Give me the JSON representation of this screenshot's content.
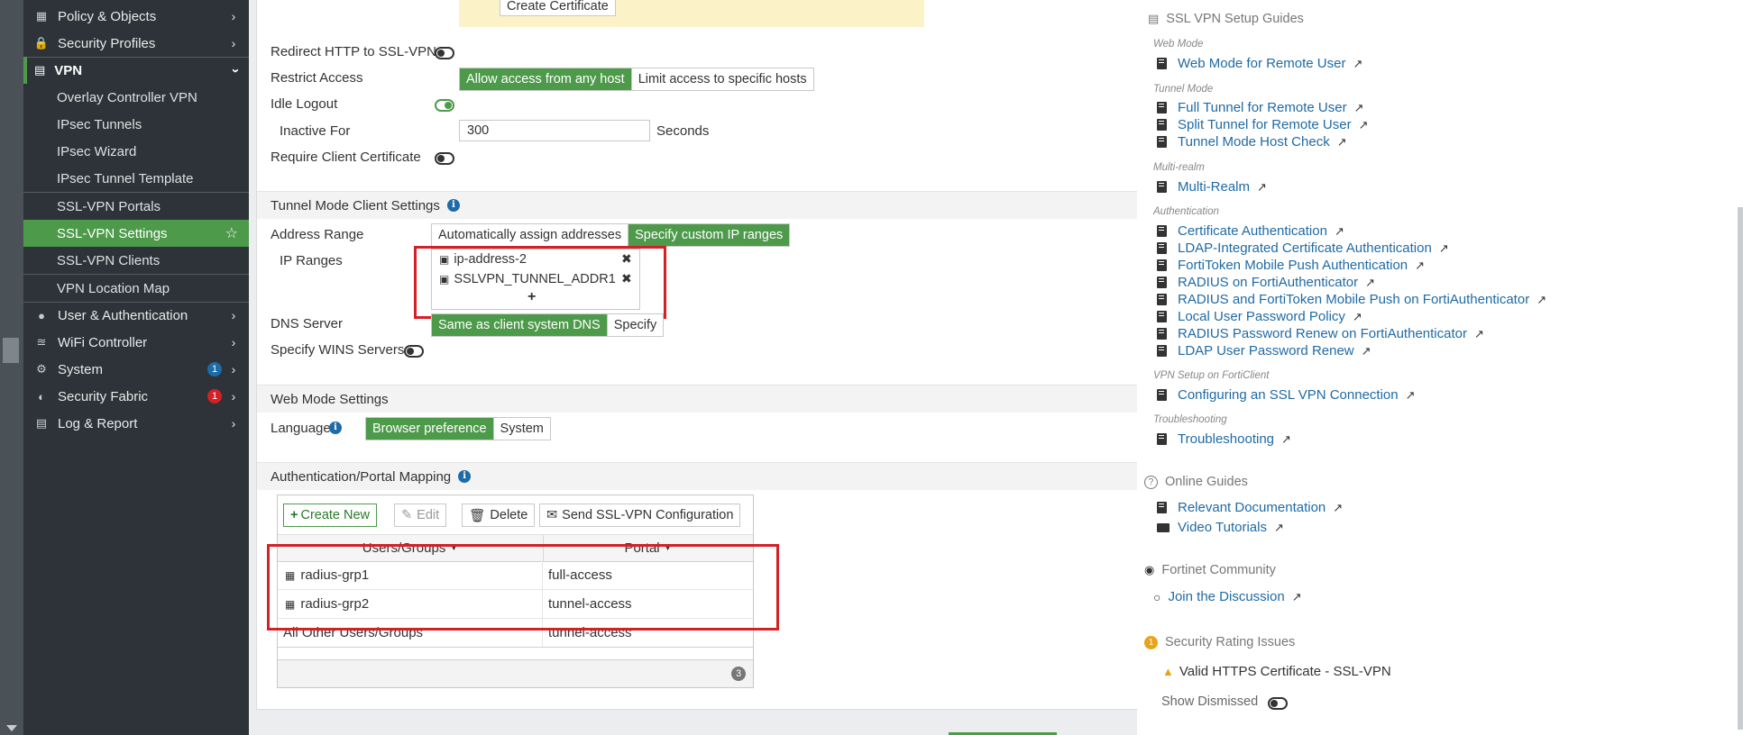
{
  "sidebar": {
    "items_top": [
      {
        "label": "Policy & Objects",
        "icon": "policy-icon"
      },
      {
        "label": "Security Profiles",
        "icon": "lock-icon"
      }
    ],
    "vpn_label": "VPN",
    "vpn_subitems": [
      "Overlay Controller VPN",
      "IPsec Tunnels",
      "IPsec Wizard",
      "IPsec Tunnel Template",
      "SSL-VPN Portals",
      "SSL-VPN Settings",
      "SSL-VPN Clients",
      "VPN Location Map"
    ],
    "active_subitem": "SSL-VPN Settings",
    "items_bottom": [
      {
        "label": "User & Authentication",
        "icon": "user-icon"
      },
      {
        "label": "WiFi Controller",
        "icon": "wifi-icon"
      },
      {
        "label": "System",
        "icon": "gear-icon",
        "badge": "1",
        "badge_color": "#1d6ba8"
      },
      {
        "label": "Security Fabric",
        "icon": "fabric-icon",
        "badge": "1",
        "badge_color": "#d42027"
      },
      {
        "label": "Log & Report",
        "icon": "chart-icon"
      }
    ]
  },
  "main": {
    "create_certificate": "Create Certificate",
    "redirect_http": "Redirect HTTP to SSL-VPN",
    "restrict_access": {
      "label": "Restrict Access",
      "options": [
        "Allow access from any host",
        "Limit access to specific hosts"
      ],
      "selected": 0
    },
    "idle_logout": "Idle Logout",
    "inactive_for": {
      "label": "Inactive For",
      "value": "300",
      "unit": "Seconds"
    },
    "require_client_cert": "Require Client Certificate",
    "tunnel_section": "Tunnel Mode Client Settings",
    "address_range": {
      "label": "Address Range",
      "options": [
        "Automatically assign addresses",
        "Specify custom IP ranges"
      ],
      "selected": 1
    },
    "ip_ranges": {
      "label": "IP Ranges",
      "items": [
        "ip-address-2",
        "SSLVPN_TUNNEL_ADDR1"
      ],
      "add": "+"
    },
    "dns_server": {
      "label": "DNS Server",
      "options": [
        "Same as client system DNS",
        "Specify"
      ],
      "selected": 0
    },
    "wins": "Specify WINS Servers",
    "web_section": "Web Mode Settings",
    "language": {
      "label": "Language",
      "options": [
        "Browser preference",
        "System"
      ],
      "selected": 0
    },
    "auth_section": "Authentication/Portal Mapping",
    "toolbar": {
      "create": "Create New",
      "edit": "Edit",
      "delete": "Delete",
      "send": "Send SSL-VPN Configuration"
    },
    "table": {
      "headers": [
        "Users/Groups",
        "Portal"
      ],
      "rows": [
        {
          "group": "radius-grp1",
          "portal": "full-access"
        },
        {
          "group": "radius-grp2",
          "portal": "tunnel-access"
        },
        {
          "group": "All Other Users/Groups",
          "portal": "tunnel-access"
        }
      ],
      "count": "3"
    }
  },
  "right": {
    "setup_guides": "SSL VPN Setup Guides",
    "groups": [
      {
        "category": "Web Mode",
        "links": [
          "Web Mode for Remote User"
        ]
      },
      {
        "category": "Tunnel Mode",
        "links": [
          "Full Tunnel for Remote User",
          "Split Tunnel for Remote User",
          "Tunnel Mode Host Check"
        ]
      },
      {
        "category": "Multi-realm",
        "links": [
          "Multi-Realm"
        ]
      },
      {
        "category": "Authentication",
        "links": [
          "Certificate Authentication",
          "LDAP-Integrated Certificate Authentication",
          "FortiToken Mobile Push Authentication",
          "RADIUS on FortiAuthenticator",
          "RADIUS and FortiToken Mobile Push on FortiAuthenticator",
          "Local User Password Policy",
          "RADIUS Password Renew on FortiAuthenticator",
          "LDAP User Password Renew"
        ]
      },
      {
        "category": "VPN Setup on FortiClient",
        "links": [
          "Configuring an SSL VPN Connection"
        ]
      },
      {
        "category": "Troubleshooting",
        "links": [
          "Troubleshooting"
        ]
      }
    ],
    "online_guides": "Online Guides",
    "online_links": [
      "Relevant Documentation",
      "Video Tutorials"
    ],
    "community": "Fortinet Community",
    "community_link": "Join the Discussion",
    "rating": "Security Rating Issues",
    "rating_badge": "1",
    "rating_item": "Valid HTTPS Certificate - SSL-VPN",
    "show_dismissed": "Show Dismissed"
  }
}
